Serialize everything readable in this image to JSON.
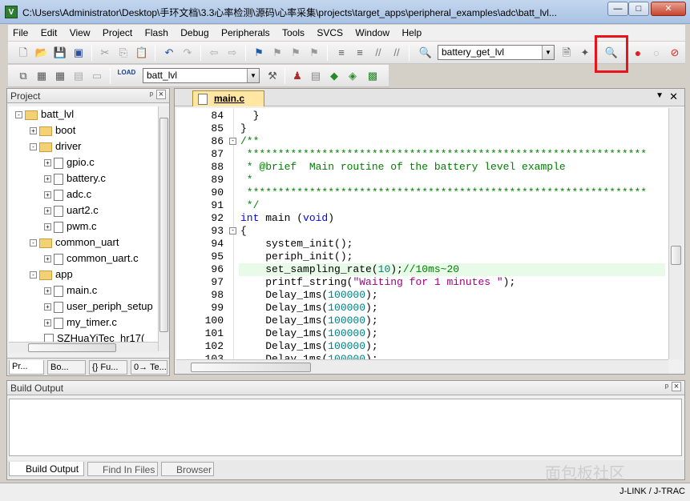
{
  "window": {
    "title": "C:\\Users\\Administrator\\Desktop\\手环文档\\3.3心率检测\\源码\\心率采集\\projects\\target_apps\\peripheral_examples\\adc\\batt_lvl...",
    "app_icon_label": "V",
    "controls": {
      "minimize": "—",
      "maximize": "□",
      "close": "✕"
    }
  },
  "menu": [
    "File",
    "Edit",
    "View",
    "Project",
    "Flash",
    "Debug",
    "Peripherals",
    "Tools",
    "SVCS",
    "Window",
    "Help"
  ],
  "toolbar1": {
    "find_combo_value": "battery_get_lvl"
  },
  "toolbar2": {
    "target_combo_value": "batt_lvl",
    "load_label": "LOAD"
  },
  "project_pane": {
    "title": "Project",
    "pin": "ᵖ",
    "close": "×",
    "tree": [
      {
        "label": "batt_lvl",
        "type": "root",
        "level": 0,
        "expander": "-"
      },
      {
        "label": "boot",
        "type": "folder",
        "level": 1,
        "expander": "+"
      },
      {
        "label": "driver",
        "type": "folder",
        "level": 1,
        "expander": "-"
      },
      {
        "label": "gpio.c",
        "type": "file",
        "level": 2,
        "expander": "+"
      },
      {
        "label": "battery.c",
        "type": "file",
        "level": 2,
        "expander": "+"
      },
      {
        "label": "adc.c",
        "type": "file",
        "level": 2,
        "expander": "+"
      },
      {
        "label": "uart2.c",
        "type": "file",
        "level": 2,
        "expander": "+"
      },
      {
        "label": "pwm.c",
        "type": "file",
        "level": 2,
        "expander": "+"
      },
      {
        "label": "common_uart",
        "type": "folder",
        "level": 1,
        "expander": "-"
      },
      {
        "label": "common_uart.c",
        "type": "file",
        "level": 2,
        "expander": "+"
      },
      {
        "label": "app",
        "type": "folder",
        "level": 1,
        "expander": "-"
      },
      {
        "label": "main.c",
        "type": "file",
        "level": 2,
        "expander": "+"
      },
      {
        "label": "user_periph_setup",
        "type": "file",
        "level": 2,
        "expander": "+"
      },
      {
        "label": "my_timer.c",
        "type": "file",
        "level": 2,
        "expander": "+"
      },
      {
        "label": "SZHuaYiTec_hr17(",
        "type": "file",
        "level": 2,
        "expander": ""
      }
    ],
    "tabs": [
      "Pr...",
      "Bo...",
      "{} Fu...",
      "0→ Te..."
    ]
  },
  "editor": {
    "tab_label": "main.c",
    "lines": [
      {
        "n": "84",
        "text": "  }",
        "fold": "",
        "cls": ""
      },
      {
        "n": "85",
        "text": "}",
        "fold": "",
        "cls": ""
      },
      {
        "n": "86",
        "text": "/**",
        "fold": "-",
        "cls": "cm"
      },
      {
        "n": "87",
        "text": " ****************************************************************",
        "fold": "",
        "cls": "cm"
      },
      {
        "n": "88",
        "text": " * @brief  Main routine of the battery level example",
        "fold": "",
        "cls": "cm"
      },
      {
        "n": "89",
        "text": " *",
        "fold": "",
        "cls": "cm"
      },
      {
        "n": "90",
        "text": " ****************************************************************",
        "fold": "",
        "cls": "cm"
      },
      {
        "n": "91",
        "text": " */",
        "fold": "",
        "cls": "cm"
      },
      {
        "n": "92",
        "text": "int main (void)",
        "fold": "",
        "cls": "main"
      },
      {
        "n": "93",
        "text": "{",
        "fold": "-",
        "cls": ""
      },
      {
        "n": "94",
        "text": "    system_init();",
        "fold": "",
        "cls": ""
      },
      {
        "n": "95",
        "text": "    periph_init();",
        "fold": "",
        "cls": ""
      },
      {
        "n": "96",
        "text": "    set_sampling_rate(10);//10ms~20",
        "fold": "",
        "cls": "rate"
      },
      {
        "n": "97",
        "text": "    printf_string(\"Waiting for 1 minutes \");",
        "fold": "",
        "cls": "printf"
      },
      {
        "n": "98",
        "text": "    Delay_1ms(100000);",
        "fold": "",
        "cls": "delay"
      },
      {
        "n": "99",
        "text": "    Delay_1ms(100000);",
        "fold": "",
        "cls": "delay"
      },
      {
        "n": "100",
        "text": "    Delay_1ms(100000);",
        "fold": "",
        "cls": "delay"
      },
      {
        "n": "101",
        "text": "    Delay_1ms(100000);",
        "fold": "",
        "cls": "delay"
      },
      {
        "n": "102",
        "text": "    Delay_1ms(100000);",
        "fold": "",
        "cls": "delay"
      },
      {
        "n": "103",
        "text": "    Delay_1ms(100000);",
        "fold": "",
        "cls": "delay"
      }
    ],
    "current_line": "96"
  },
  "build_pane": {
    "title": "Build Output",
    "tabs": [
      "Build Output",
      "Find In Files",
      "Browser"
    ]
  },
  "status": {
    "debugger": "J-LINK / J-TRAC"
  },
  "watermark": "面包板社区"
}
